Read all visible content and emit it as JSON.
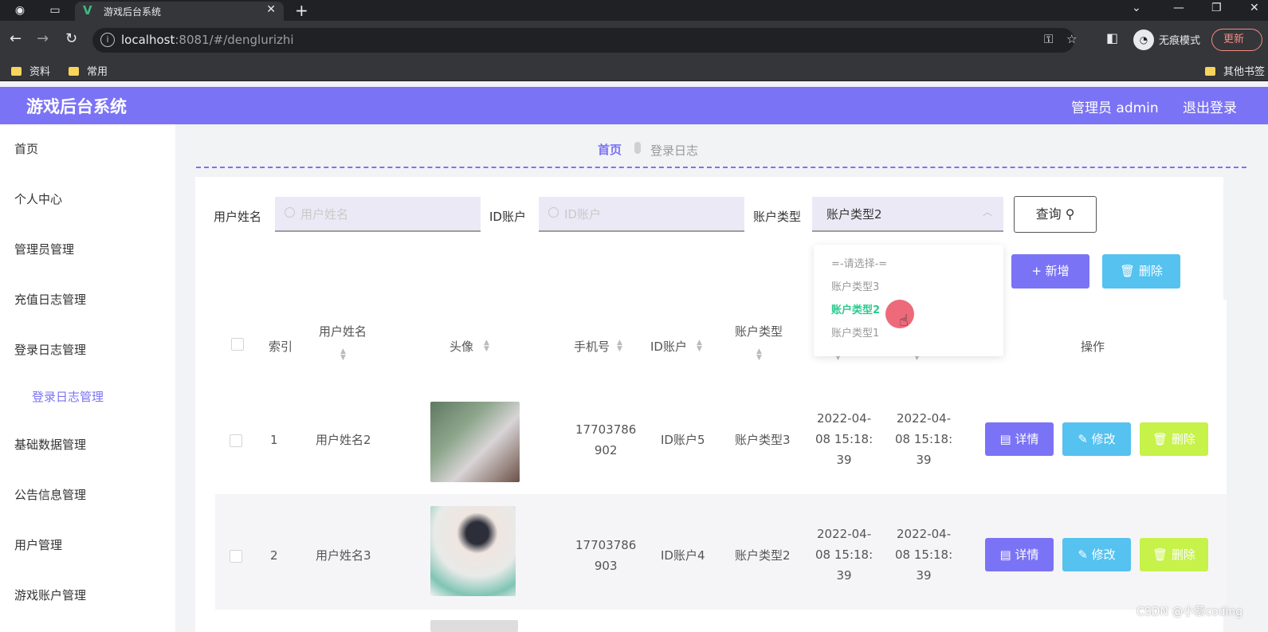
{
  "browser": {
    "tab_title": "游戏后台系统",
    "url_host": "localhost",
    "url_path": ":8081/#/denglurizhi",
    "incognito_label": "无痕模式",
    "update_label": "更新",
    "bookmarks": [
      "资料",
      "常用",
      "其他书签"
    ]
  },
  "header": {
    "title": "游戏后台系统",
    "admin": "管理员 admin",
    "logout": "退出登录"
  },
  "sidebar": {
    "items": [
      "首页",
      "个人中心",
      "管理员管理",
      "充值日志管理",
      "登录日志管理",
      "登录日志管理",
      "基础数据管理",
      "公告信息管理",
      "用户管理",
      "游戏账户管理"
    ]
  },
  "breadcrumb": {
    "home": "首页",
    "current": "登录日志"
  },
  "filters": {
    "username_label": "用户姓名",
    "username_placeholder": "用户姓名",
    "id_label": "ID账户",
    "id_placeholder": "ID账户",
    "type_label": "账户类型",
    "type_value": "账户类型2",
    "query_label": "查询"
  },
  "dropdown": {
    "options": [
      "=-请选择-=",
      "账户类型3",
      "账户类型2",
      "账户类型1"
    ],
    "selected": "账户类型2"
  },
  "actions": {
    "add": "+ 新增",
    "delete": "删除"
  },
  "table": {
    "headers": [
      "索引",
      "用户姓名",
      "头像",
      "手机号",
      "ID账户",
      "账户类型",
      "操作"
    ],
    "rows": [
      {
        "index": "1",
        "name": "用户姓名2",
        "phone1": "17703786",
        "phone2": "902",
        "id": "ID账户5",
        "type": "账户类型3",
        "d1a": "2022-04-",
        "d1b": "08 15:18:",
        "d1c": "39",
        "d2a": "2022-04-",
        "d2b": "08 15:18:",
        "d2c": "39"
      },
      {
        "index": "2",
        "name": "用户姓名3",
        "phone1": "17703786",
        "phone2": "903",
        "id": "ID账户4",
        "type": "账户类型2",
        "d1a": "2022-04-",
        "d1b": "08 15:18:",
        "d1c": "39",
        "d2a": "2022-04-",
        "d2b": "08 15:18:",
        "d2c": "39"
      }
    ],
    "row_actions": {
      "detail": "详情",
      "edit": "修改",
      "delete": "删除"
    }
  },
  "watermark": "CSDN @小蔡coding"
}
